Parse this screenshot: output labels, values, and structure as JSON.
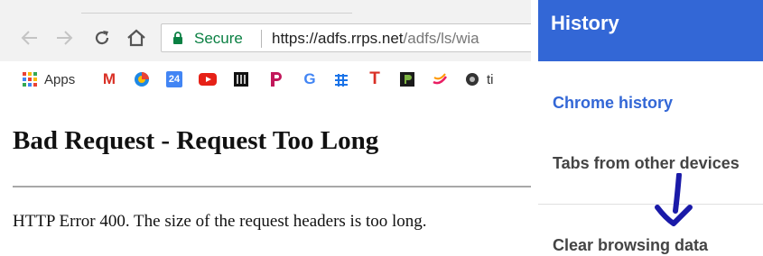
{
  "browser": {
    "security_label": "Secure",
    "url_host": "https://adfs.rrps.net",
    "url_path": "/adfs/ls/wia",
    "bookmarks": {
      "apps_label": "Apps",
      "gmail_glyph": "M",
      "calendar_glyph": "24",
      "google_glyph": "G",
      "t_glyph": "T",
      "last_label": "ti"
    }
  },
  "page": {
    "title": "Bad Request - Request Too Long",
    "message": "HTTP Error 400. The size of the request headers is too long."
  },
  "history_panel": {
    "title": "History",
    "items": [
      {
        "label": "Chrome history"
      },
      {
        "label": "Tabs from other devices"
      },
      {
        "label": "Clear browsing data"
      }
    ]
  },
  "colors": {
    "panel_header": "#3367d6",
    "active_item": "#3367d6",
    "secure_green": "#0b8043",
    "annotation_arrow": "#1a1aa8"
  },
  "icons": [
    "back-arrow-icon",
    "forward-arrow-icon",
    "reload-icon",
    "home-icon",
    "lock-icon",
    "apps-grid-icon",
    "annotation-arrow-icon"
  ]
}
